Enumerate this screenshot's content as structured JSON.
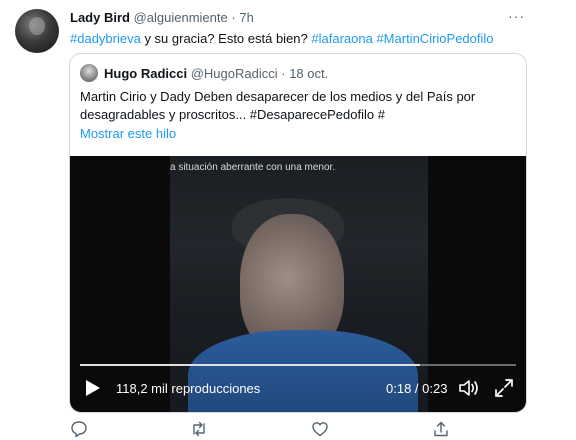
{
  "tweet": {
    "display_name": "Lady Bird",
    "handle": "@alguienmiente",
    "separator": "·",
    "time": "7h",
    "more_label": "···",
    "text_parts": [
      "#dadybrieva",
      " y su gracia? Esto está bien? ",
      "#lafaraona",
      " ",
      "#MartinCirioPedofilo"
    ]
  },
  "quote": {
    "display_name": "Hugo Radicci",
    "handle": "@HugoRadicci",
    "separator": "·",
    "date": "18 oct.",
    "text": "Martin Cirio y Dady Deben desaparecer de los medios y del País por desagradables y proscritos... #DesaparecePedofilo #",
    "thread_link": "Mostrar este hilo"
  },
  "video": {
    "caption": "a situación aberrante con una menor.",
    "views": "118,2 mil reproducciones",
    "timecode": "0:18 / 0:23",
    "progress_fraction": 0.78
  },
  "colors": {
    "link": "#1d9bf0",
    "secondary_text": "#536471",
    "border": "#cfd9de"
  },
  "icons": [
    "play-icon",
    "volume-icon",
    "fullscreen-icon",
    "reply-icon",
    "retweet-icon",
    "like-icon",
    "share-icon"
  ]
}
